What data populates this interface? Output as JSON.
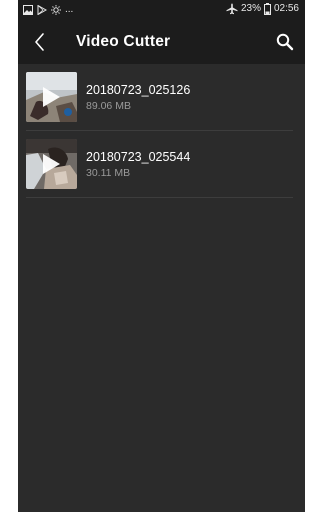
{
  "status_bar": {
    "left_icons": [
      "image-icon",
      "play-store-icon",
      "brightness-icon"
    ],
    "more_indicator": "...",
    "battery_percent": "23%",
    "time": "02:56",
    "right_icons": [
      "airplane-mode-icon",
      "battery-icon"
    ]
  },
  "app_bar": {
    "title": "Video Cutter",
    "back_icon": "back-arrow-icon",
    "search_icon": "search-icon"
  },
  "videos": [
    {
      "name": "20180723_025126",
      "size": "89.06 MB",
      "thumbnail": "video-thumbnail",
      "overlay_icon": "play-icon"
    },
    {
      "name": "20180723_025544",
      "size": "30.11 MB",
      "thumbnail": "video-thumbnail",
      "overlay_icon": "play-icon"
    }
  ],
  "colors": {
    "background": "#2b2b2b",
    "bars": "#1c1c1c",
    "primary_text": "#ffffff",
    "secondary_text": "#9a9a9a",
    "divider": "#3d3d3d"
  }
}
